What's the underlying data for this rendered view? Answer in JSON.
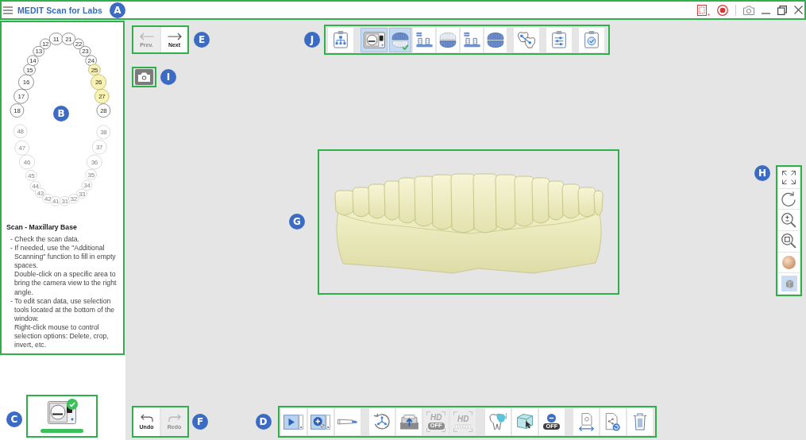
{
  "title_bar": {
    "app_title": "MEDIT Scan for Labs",
    "callout": "A"
  },
  "tooth_chart": {
    "callout": "B",
    "upper": {
      "disabled": false,
      "teeth": [
        {
          "number": "18",
          "selected": false
        },
        {
          "number": "17",
          "selected": false
        },
        {
          "number": "16",
          "selected": false
        },
        {
          "number": "15",
          "selected": false
        },
        {
          "number": "14",
          "selected": false
        },
        {
          "number": "13",
          "selected": false
        },
        {
          "number": "12",
          "selected": false
        },
        {
          "number": "11",
          "selected": false
        },
        {
          "number": "21",
          "selected": false
        },
        {
          "number": "22",
          "selected": false
        },
        {
          "number": "23",
          "selected": false
        },
        {
          "number": "24",
          "selected": false
        },
        {
          "number": "25",
          "selected": true
        },
        {
          "number": "26",
          "selected": true
        },
        {
          "number": "27",
          "selected": true
        },
        {
          "number": "28",
          "selected": false
        }
      ]
    },
    "lower": {
      "disabled": true,
      "teeth": [
        {
          "number": "48",
          "selected": false
        },
        {
          "number": "47",
          "selected": false
        },
        {
          "number": "46",
          "selected": false
        },
        {
          "number": "45",
          "selected": false
        },
        {
          "number": "44",
          "selected": false
        },
        {
          "number": "43",
          "selected": false
        },
        {
          "number": "42",
          "selected": false
        },
        {
          "number": "41",
          "selected": false
        },
        {
          "number": "31",
          "selected": false
        },
        {
          "number": "32",
          "selected": false
        },
        {
          "number": "33",
          "selected": false
        },
        {
          "number": "34",
          "selected": false
        },
        {
          "number": "35",
          "selected": false
        },
        {
          "number": "36",
          "selected": false
        },
        {
          "number": "37",
          "selected": false
        },
        {
          "number": "38",
          "selected": false
        }
      ]
    }
  },
  "instructions": {
    "title": "Scan - Maxillary Base",
    "items": [
      {
        "text": "- Check the scan data."
      },
      {
        "text": "- If needed, use the \"Additional Scanning\" function to fill in empty spaces.",
        "note": "Double-click on a specific area to bring the camera view to the right angle."
      },
      {
        "text": "- To edit scan data, use selection tools located at the bottom of the window.",
        "note": "Right-click mouse to control selection options: Delete, crop, invert, etc."
      }
    ]
  },
  "navigation": {
    "callout": "E",
    "buttons": [
      {
        "kind": "prev",
        "label": "Prev.",
        "disabled": true
      },
      {
        "kind": "next",
        "label": "Next",
        "disabled": false
      }
    ]
  },
  "step_toolbar": {
    "callout": "J",
    "groups": [
      {
        "steps": [
          {
            "kind": "workflow",
            "selected": false,
            "done": false
          }
        ]
      },
      {
        "steps": [
          {
            "kind": "scanner",
            "selected": true,
            "done": false
          },
          {
            "kind": "maxilla",
            "selected": true,
            "done": true
          },
          {
            "kind": "abutment",
            "selected": false,
            "done": false
          },
          {
            "kind": "mandible",
            "selected": false,
            "done": false
          },
          {
            "kind": "abutment",
            "selected": false,
            "done": false
          },
          {
            "kind": "occlusion",
            "selected": false,
            "done": false
          }
        ]
      },
      {
        "steps": [
          {
            "kind": "alignment",
            "selected": false,
            "done": false
          }
        ]
      },
      {
        "steps": [
          {
            "kind": "settings",
            "selected": false,
            "done": false
          }
        ]
      },
      {
        "steps": [
          {
            "kind": "complete",
            "selected": false,
            "done": false
          }
        ]
      }
    ]
  },
  "capture": {
    "callout": "I"
  },
  "model_view": {
    "callout": "G"
  },
  "view_toolbar": {
    "callout": "H",
    "tools": [
      {
        "kind": "fit"
      },
      {
        "kind": "reset"
      },
      {
        "kind": "zoom"
      },
      {
        "kind": "zoomarea"
      },
      {
        "kind": "material"
      },
      {
        "kind": "viewcube"
      }
    ]
  },
  "scanner": {
    "callout": "C",
    "connected": true
  },
  "history": {
    "callout": "F",
    "buttons": [
      {
        "kind": "undo",
        "label": "Undo",
        "disabled": false
      },
      {
        "kind": "redo",
        "label": "Redo",
        "disabled": true
      }
    ]
  },
  "tool_bar": {
    "callout": "D",
    "groups": [
      {
        "tools": [
          {
            "kind": "play",
            "selected": true,
            "disabled": false
          },
          {
            "kind": "addscan",
            "selected": true,
            "disabled": false
          },
          {
            "kind": "scantip",
            "selected": false,
            "disabled": false
          }
        ]
      },
      {
        "tools": [
          {
            "kind": "rotate",
            "selected": false,
            "disabled": false
          },
          {
            "kind": "scanupload",
            "selected": false,
            "disabled": false
          },
          {
            "kind": "hd",
            "label": "HD",
            "toggle": "OFF",
            "selected": false,
            "disabled": true
          },
          {
            "kind": "hdteeth",
            "label": "HD",
            "selected": false,
            "disabled": true
          }
        ]
      },
      {
        "tools": [
          {
            "kind": "toothselect",
            "selected": false,
            "disabled": false
          },
          {
            "kind": "cubeselect",
            "selected": false,
            "disabled": false
          },
          {
            "kind": "remove",
            "toggle": "OFF",
            "selected": false,
            "disabled": false
          }
        ]
      },
      {
        "tools": [
          {
            "kind": "transfer",
            "selected": false,
            "disabled": false
          },
          {
            "kind": "share",
            "selected": false,
            "disabled": false
          },
          {
            "kind": "trash",
            "selected": false,
            "disabled": false
          }
        ]
      }
    ]
  }
}
